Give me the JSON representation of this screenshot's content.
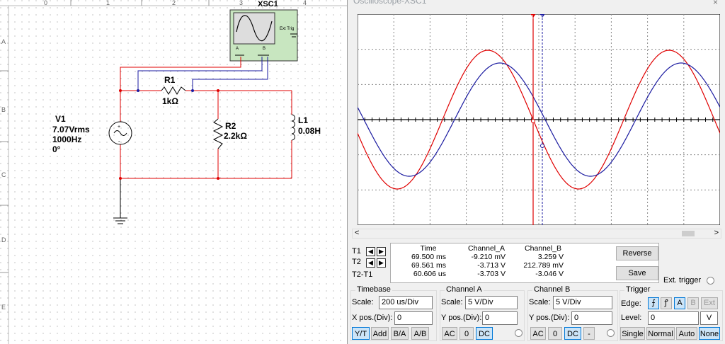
{
  "colors": {
    "channel_a": "#e00000",
    "channel_b": "#1a1aa0",
    "wire": "#e00000",
    "screen_bg": "#ffffff",
    "accent": "#0078d7"
  },
  "schematic": {
    "ruler_numbers": [
      "0",
      "1",
      "2",
      "3",
      "4"
    ],
    "ruler_letters": [
      "A",
      "B",
      "C",
      "D",
      "E"
    ],
    "instrument": {
      "name": "XSC1",
      "ext_trig": "Ext Trig",
      "port_a": "A",
      "port_b": "B"
    },
    "v1": {
      "name": "V1",
      "value": "7.07Vrms",
      "freq": "1000Hz",
      "phase": "0°"
    },
    "r1": {
      "name": "R1",
      "value": "1kΩ"
    },
    "r2": {
      "name": "R2",
      "value": "2.2kΩ"
    },
    "l1": {
      "name": "L1",
      "value": "0.08H"
    }
  },
  "scope": {
    "title": "Oscilloscope-XSC1",
    "close": "×",
    "cursor_t1": "1",
    "cursor_t2": "2",
    "scroll_left": "<",
    "scroll_right": ">",
    "readout": {
      "headers": [
        "Time",
        "Channel_A",
        "Channel_B"
      ],
      "rows": [
        {
          "label": "T1",
          "time": "69.500 ms",
          "a": "-9.210 mV",
          "b": "3.259 V"
        },
        {
          "label": "T2",
          "time": "69.561 ms",
          "a": "-3.713 V",
          "b": "212.789 mV"
        },
        {
          "label": "T2-T1",
          "time": "60.606 us",
          "a": "-3.703 V",
          "b": "-3.046 V"
        }
      ]
    },
    "reverse": "Reverse",
    "save": "Save",
    "ext_trigger": "Ext. trigger",
    "timebase": {
      "title": "Timebase",
      "scale_label": "Scale:",
      "scale": "200 us/Div",
      "pos_label": "X pos.(Div):",
      "pos": "0",
      "buttons": [
        "Y/T",
        "Add",
        "B/A",
        "A/B"
      ]
    },
    "channel_a": {
      "title": "Channel A",
      "scale_label": "Scale:",
      "scale": "5  V/Div",
      "pos_label": "Y pos.(Div):",
      "pos": "0",
      "buttons": [
        "AC",
        "0",
        "DC"
      ]
    },
    "channel_b": {
      "title": "Channel B",
      "scale_label": "Scale:",
      "scale": "5  V/Div",
      "pos_label": "Y pos.(Div):",
      "pos": "0",
      "buttons": [
        "AC",
        "0",
        "DC",
        "-"
      ]
    },
    "trigger": {
      "title": "Trigger",
      "edge_label": "Edge:",
      "edge_rise": "⨍",
      "edge_fall": "ꝭ",
      "src_a": "A",
      "src_b": "B",
      "src_ext": "Ext",
      "level_label": "Level:",
      "level": "0",
      "level_unit": "V",
      "modes": [
        "Single",
        "Normal",
        "Auto",
        "None"
      ]
    }
  }
}
